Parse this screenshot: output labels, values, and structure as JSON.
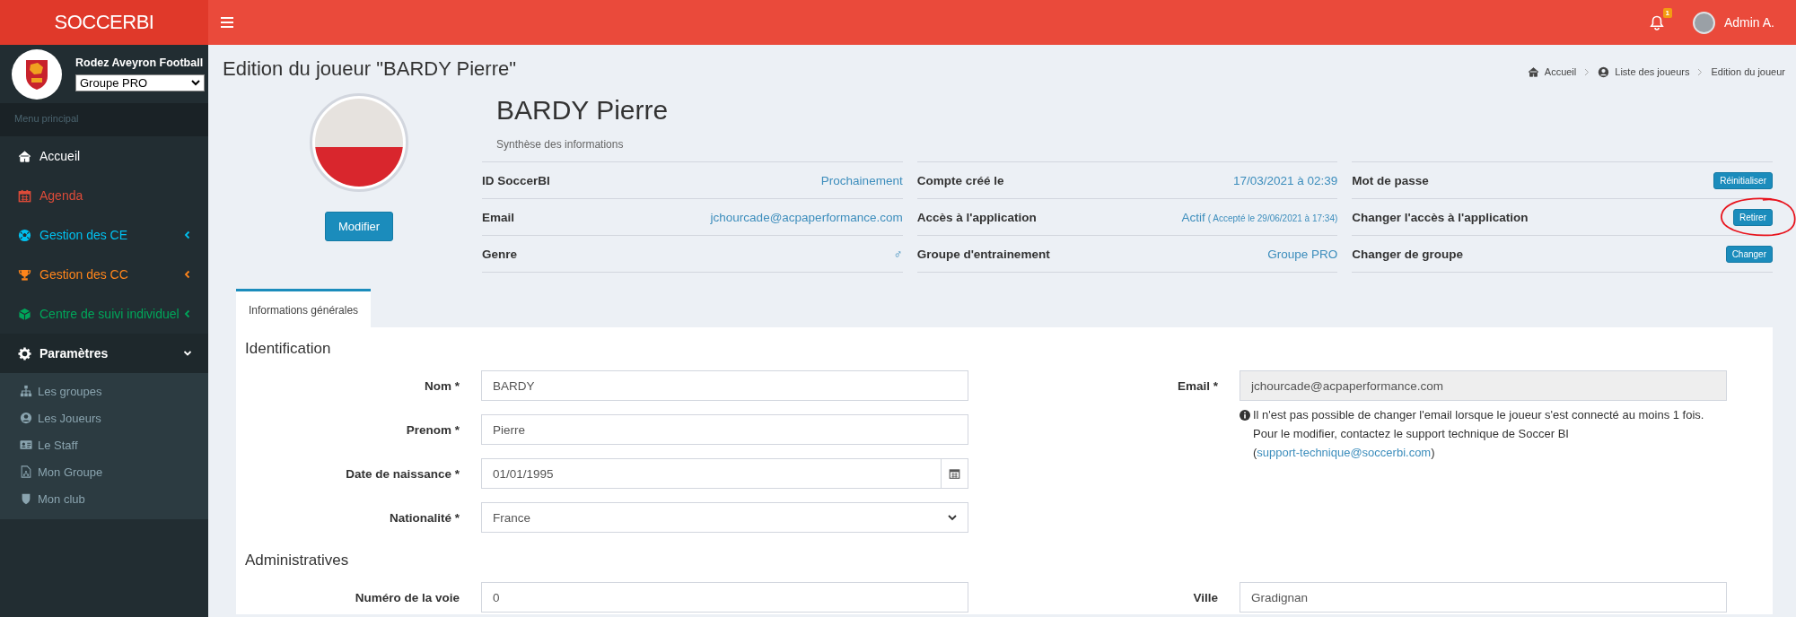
{
  "header": {
    "logo": "SOCCERBI",
    "notifications": {
      "count": "1"
    },
    "user": {
      "name": "Admin A."
    }
  },
  "sidebar": {
    "club": {
      "name": "Rodez Aveyron Football",
      "group": "Groupe PRO"
    },
    "section_title": "Menu principal",
    "items": [
      {
        "label": "Accueil",
        "color": "#ffffff",
        "selected": false
      },
      {
        "label": "Agenda",
        "color": "#dd4b39",
        "selected": false
      },
      {
        "label": "Gestion des CE",
        "color": "#00c0ef",
        "expanded": false,
        "selected": false
      },
      {
        "label": "Gestion des CC",
        "color": "#ff851b",
        "expanded": false,
        "selected": false
      },
      {
        "label": "Centre de suivi individuel",
        "color": "#00a65a",
        "expanded": false,
        "selected": false
      },
      {
        "label": "Paramètres",
        "color": "#ffffff",
        "expanded": true,
        "selected": true,
        "children": [
          {
            "label": "Les groupes"
          },
          {
            "label": "Les Joueurs"
          },
          {
            "label": "Le Staff"
          },
          {
            "label": "Mon Groupe"
          },
          {
            "label": "Mon club"
          }
        ]
      }
    ]
  },
  "page": {
    "title": "Edition du joueur \"BARDY Pierre\"",
    "breadcrumb": [
      {
        "label": "Accueil"
      },
      {
        "label": "Liste des joueurs"
      },
      {
        "label": "Edition du joueur"
      }
    ]
  },
  "profile": {
    "edit_button": "Modifier",
    "name": "BARDY Pierre",
    "subtitle": "Synthèse des informations",
    "columns": [
      [
        {
          "label": "ID SoccerBI",
          "kind": "text",
          "value": "Prochainement"
        },
        {
          "label": "Email",
          "kind": "text",
          "value": "jchourcade@acpaperformance.com"
        },
        {
          "label": "Genre",
          "kind": "text",
          "value": "♂"
        }
      ],
      [
        {
          "label": "Compte créé le",
          "kind": "text",
          "value": "17/03/2021 à 02:39"
        },
        {
          "label": "Accès à l'application",
          "kind": "text",
          "value": "Actif",
          "note": "( Accepté le 29/06/2021 à 17:34)"
        },
        {
          "label": "Groupe d'entrainement",
          "kind": "text",
          "value": "Groupe PRO"
        }
      ],
      [
        {
          "label": "Mot de passe",
          "kind": "button",
          "value": "Réinitialiser",
          "circled": false
        },
        {
          "label": "Changer l'accès à l'application",
          "kind": "button",
          "value": "Retirer",
          "circled": true
        },
        {
          "label": "Changer de groupe",
          "kind": "button",
          "value": "Changer",
          "circled": false
        }
      ]
    ]
  },
  "tabs": [
    {
      "label": "Informations générales",
      "selected": true
    }
  ],
  "sections": [
    {
      "title": "Identification",
      "left": [
        {
          "label": "Nom *",
          "kind": "text",
          "value": "BARDY"
        },
        {
          "label": "Prenom *",
          "kind": "text",
          "value": "Pierre"
        },
        {
          "label": "Date de naissance *",
          "kind": "date",
          "value": "01/01/1995"
        },
        {
          "label": "Nationalité *",
          "kind": "select",
          "value": "France"
        }
      ],
      "right": [
        {
          "label": "Email *",
          "kind": "readonly",
          "value": "jchourcade@acpaperformance.com",
          "help": {
            "text": "Il n'est pas possible de changer l'email lorsque le joueur s'est connecté au moins 1 fois. Pour le modifier, contactez le support technique de Soccer BI (",
            "link": "support-technique@soccerbi.com",
            "after": ")"
          }
        }
      ]
    },
    {
      "title": "Administratives",
      "left": [
        {
          "label": "Numéro de la voie",
          "kind": "text",
          "value": "0"
        }
      ],
      "right": [
        {
          "label": "Ville",
          "kind": "text",
          "value": "Gradignan"
        }
      ]
    }
  ]
}
